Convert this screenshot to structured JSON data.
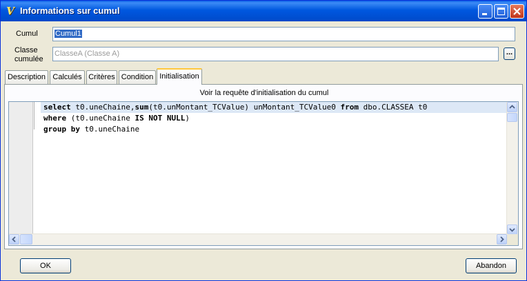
{
  "window": {
    "title": "Informations sur cumul",
    "app_icon": "v-app-icon"
  },
  "form": {
    "cumul_label": "Cumul",
    "cumul_value": "Cumul1",
    "classe_label_line1": "Classe",
    "classe_label_line2": "cumulée",
    "classe_value": "ClasseA (Classe A)",
    "browse_label": "..."
  },
  "tabs": [
    {
      "label": "Description",
      "active": false
    },
    {
      "label": "Calculés",
      "active": false
    },
    {
      "label": "Critères",
      "active": false
    },
    {
      "label": "Condition",
      "active": false
    },
    {
      "label": "Initialisation",
      "active": true
    }
  ],
  "panel": {
    "caption": "Voir la requête d'initialisation du cumul",
    "code_lines": [
      [
        {
          "t": "select",
          "kw": true
        },
        {
          "t": " t0.uneChaine,",
          "kw": false
        },
        {
          "t": "sum",
          "kw": true
        },
        {
          "t": "(t0.unMontant_TCValue) unMontant_TCValue0 ",
          "kw": false
        },
        {
          "t": "from",
          "kw": true
        },
        {
          "t": " dbo.CLASSEA t0",
          "kw": false
        }
      ],
      [
        {
          "t": "where",
          "kw": true
        },
        {
          "t": " (t0.uneChaine ",
          "kw": false
        },
        {
          "t": "IS NOT NULL",
          "kw": true
        },
        {
          "t": ")",
          "kw": false
        }
      ],
      [
        {
          "t": "group by",
          "kw": true
        },
        {
          "t": " t0.uneChaine",
          "kw": false
        }
      ]
    ]
  },
  "buttons": {
    "ok": "OK",
    "cancel": "Abandon"
  }
}
